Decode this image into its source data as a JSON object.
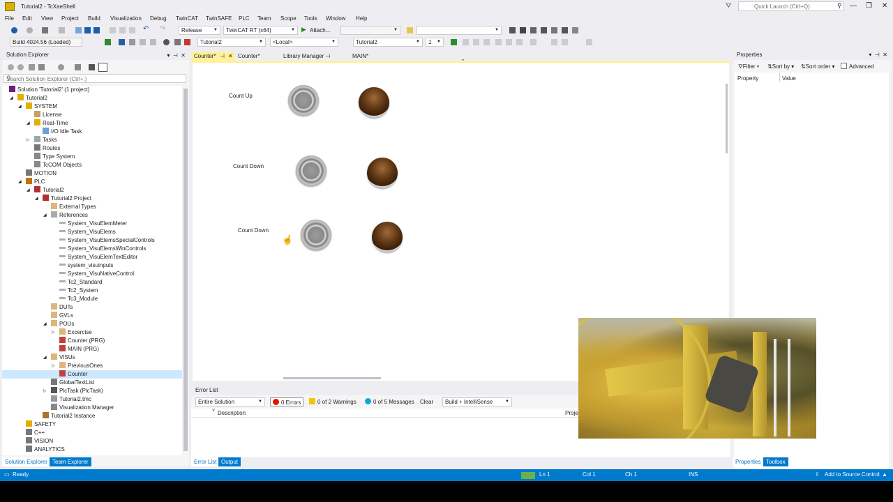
{
  "window": {
    "title": "Tutorial2 - TcXaeShell",
    "quick_launch_placeholder": "Quick Launch (Ctrl+Q)"
  },
  "menu": [
    "File",
    "Edit",
    "View",
    "Project",
    "Build",
    "Visualization",
    "Debug",
    "TwinCAT",
    "TwinSAFE",
    "PLC",
    "Team",
    "Scope",
    "Tools",
    "Window",
    "Help"
  ],
  "toolbar1": {
    "configuration": "Release",
    "platform": "TwinCAT RT (x64)",
    "attach_label": "Attach..."
  },
  "toolbar2": {
    "build": "Build 4024.56 (Loaded)",
    "target": "Tutorial2",
    "local": "<Local>",
    "project": "Tutorial2",
    "instance": "1"
  },
  "solution_explorer": {
    "title": "Solution Explorer",
    "search_placeholder": "Search Solution Explorer (Ctrl+;)",
    "tree": [
      {
        "label": "Solution 'Tutorial2' (1 project)",
        "level": 0,
        "icon": "solution-icon",
        "toggle": ""
      },
      {
        "label": "Tutorial2",
        "level": 1,
        "icon": "project-icon",
        "toggle": "expanded"
      },
      {
        "label": "SYSTEM",
        "level": 2,
        "icon": "system-icon",
        "toggle": "expanded"
      },
      {
        "label": "License",
        "level": 3,
        "icon": "license-icon",
        "toggle": ""
      },
      {
        "label": "Real-Time",
        "level": 3,
        "icon": "realtime-icon",
        "toggle": "expanded"
      },
      {
        "label": "I/O Idle Task",
        "level": 4,
        "icon": "task-icon",
        "toggle": ""
      },
      {
        "label": "Tasks",
        "level": 3,
        "icon": "tasks-icon",
        "toggle": "collapsed"
      },
      {
        "label": "Routes",
        "level": 3,
        "icon": "routes-icon",
        "toggle": ""
      },
      {
        "label": "Type System",
        "level": 3,
        "icon": "type-system-icon",
        "toggle": ""
      },
      {
        "label": "TcCOM Objects",
        "level": 3,
        "icon": "tccom-icon",
        "toggle": ""
      },
      {
        "label": "MOTION",
        "level": 2,
        "icon": "motion-icon",
        "toggle": ""
      },
      {
        "label": "PLC",
        "level": 2,
        "icon": "plc-icon",
        "toggle": "expanded"
      },
      {
        "label": "Tutorial2",
        "level": 3,
        "icon": "plc-project-icon",
        "toggle": "expanded"
      },
      {
        "label": "Tutorial2 Project",
        "level": 4,
        "icon": "plc-project-icon",
        "toggle": "expanded"
      },
      {
        "label": "External Types",
        "level": 5,
        "icon": "folder-icon",
        "toggle": ""
      },
      {
        "label": "References",
        "level": 5,
        "icon": "references-icon",
        "toggle": "expanded"
      },
      {
        "label": "System_VisuElemMeter",
        "level": 6,
        "icon": "reference-icon",
        "toggle": ""
      },
      {
        "label": "System_VisuElems",
        "level": 6,
        "icon": "reference-icon",
        "toggle": ""
      },
      {
        "label": "System_VisuElemsSpecialControls",
        "level": 6,
        "icon": "reference-icon",
        "toggle": ""
      },
      {
        "label": "System_VisuElemsWinControls",
        "level": 6,
        "icon": "reference-icon",
        "toggle": ""
      },
      {
        "label": "System_VisuElemTextEditor",
        "level": 6,
        "icon": "reference-icon",
        "toggle": ""
      },
      {
        "label": "system_visuinputs",
        "level": 6,
        "icon": "reference-icon",
        "toggle": ""
      },
      {
        "label": "System_VisuNativeControl",
        "level": 6,
        "icon": "reference-icon",
        "toggle": ""
      },
      {
        "label": "Tc2_Standard",
        "level": 6,
        "icon": "reference-icon",
        "toggle": ""
      },
      {
        "label": "Tc2_System",
        "level": 6,
        "icon": "reference-icon",
        "toggle": ""
      },
      {
        "label": "Tc3_Module",
        "level": 6,
        "icon": "reference-icon",
        "toggle": ""
      },
      {
        "label": "DUTs",
        "level": 5,
        "icon": "folder-icon",
        "toggle": ""
      },
      {
        "label": "GVLs",
        "level": 5,
        "icon": "folder-icon",
        "toggle": ""
      },
      {
        "label": "POUs",
        "level": 5,
        "icon": "folder-icon",
        "toggle": "expanded"
      },
      {
        "label": "Excercise",
        "level": 6,
        "icon": "folder-icon",
        "toggle": "collapsed"
      },
      {
        "label": "Counter (PRG)",
        "level": 6,
        "icon": "pou-icon",
        "toggle": ""
      },
      {
        "label": "MAIN (PRG)",
        "level": 6,
        "icon": "pou-icon",
        "toggle": ""
      },
      {
        "label": "VISUs",
        "level": 5,
        "icon": "folder-icon",
        "toggle": "expanded"
      },
      {
        "label": "PreviousOnes",
        "level": 6,
        "icon": "folder-icon",
        "toggle": "collapsed"
      },
      {
        "label": "Counter",
        "level": 6,
        "icon": "visu-icon",
        "toggle": "",
        "selected": true
      },
      {
        "label": "GlobalTextList",
        "level": 5,
        "icon": "textlist-icon",
        "toggle": ""
      },
      {
        "label": "PlcTask (PlcTask)",
        "level": 5,
        "icon": "plctask-icon",
        "toggle": "collapsed"
      },
      {
        "label": "Tutorial2.tmc",
        "level": 5,
        "icon": "tmc-icon",
        "toggle": ""
      },
      {
        "label": "Visualization Manager",
        "level": 5,
        "icon": "visu-manager-icon",
        "toggle": ""
      },
      {
        "label": "Tutorial2 Instance",
        "level": 4,
        "icon": "instance-icon",
        "toggle": ""
      },
      {
        "label": "SAFETY",
        "level": 2,
        "icon": "safety-icon",
        "toggle": ""
      },
      {
        "label": "C++",
        "level": 2,
        "icon": "cpp-icon",
        "toggle": ""
      },
      {
        "label": "VISION",
        "level": 2,
        "icon": "vision-icon",
        "toggle": ""
      },
      {
        "label": "ANALYTICS",
        "level": 2,
        "icon": "analytics-icon",
        "toggle": ""
      }
    ],
    "tabs": [
      "Solution Explorer",
      "Team Explorer"
    ]
  },
  "document_tabs": [
    {
      "label": "Counter*",
      "active": true
    },
    {
      "label": "Counter*",
      "active": false
    },
    {
      "label": "Library Manager",
      "active": false
    },
    {
      "label": "MAIN*",
      "active": false
    }
  ],
  "visualization": {
    "rows": [
      {
        "label": "Count Up"
      },
      {
        "label": "Count Down"
      },
      {
        "label": "Count Down"
      }
    ]
  },
  "error_list": {
    "title": "Error List",
    "scope": "Entire Solution",
    "errors": "0 Errors",
    "warnings": "0 of 2 Warnings",
    "messages": "0 of 5 Messages",
    "clear": "Clear",
    "source": "Build + IntelliSense",
    "col_description": "Description",
    "col_project": "Proje"
  },
  "bottom_tabs": [
    "Error List",
    "Output"
  ],
  "properties": {
    "title": "Properties",
    "filter": "Filter",
    "sort_by": "Sort by",
    "sort_order": "Sort order",
    "advanced": "Advanced",
    "col_property": "Property",
    "col_value": "Value",
    "tabs": [
      "Properties",
      "Toolbox"
    ]
  },
  "status_bar": {
    "ready": "Ready",
    "ln": "Ln 1",
    "col": "Col 1",
    "ch": "Ch 1",
    "ins": "INS",
    "source_control": "Add to Source Control"
  },
  "colors": {
    "accent": "#007acc",
    "active_tab": "#fff19d",
    "selection": "#cce8ff",
    "chrome": "#eeeef2"
  }
}
